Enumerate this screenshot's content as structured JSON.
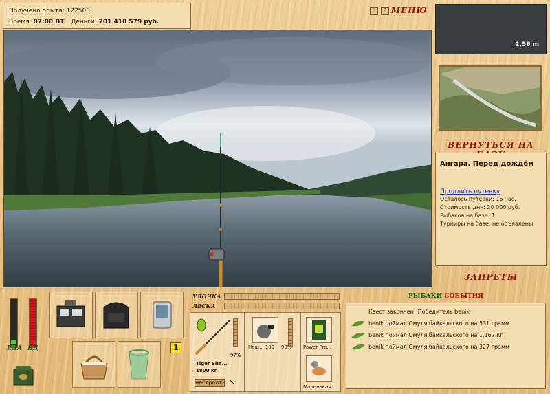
{
  "header": {
    "experience_label": "Получено опыта:",
    "experience_value": "122500",
    "time_label": "Время:",
    "time_value": "07:00 ВТ",
    "money_label": "Деньги:",
    "money_value": "201 410 579 руб.",
    "pause_icon": "II",
    "help_icon": "?",
    "menu_label": "МЕНЮ"
  },
  "depth": {
    "value": "2,56 m"
  },
  "location": {
    "return_label": "ВЕРНУТЬСЯ НА БАЗУ",
    "name": "Ангара. Перед дождём",
    "extend_link": "Продлить путевку",
    "remaining": "Осталось путевки: 16 час.",
    "cost": "Стоимость дня: 20 000 руб.",
    "fishers": "Рыбаков на базе: 1",
    "tournaments": "Турниры на базе: не объявлены",
    "bans_label": "ЗАПРЕТЫ"
  },
  "needs": {
    "food_label": "ЕДА",
    "drink_label": "ВД",
    "food_level": 0.15,
    "drink_level": 1.0
  },
  "inventory": {
    "badge": "1"
  },
  "tackle": {
    "rod_label": "УДОЧКА",
    "line_label": "ЛЕСКА",
    "rod_name": "Tiger Sha...",
    "rod_weight": "1800 кг",
    "rod_percent": "97%",
    "reel_name": "Нош... 180",
    "reel_percent": "99%",
    "lure_name": "Power Pro...",
    "bait_name": "Маленькая",
    "setup_label": "настроить"
  },
  "events": {
    "title_a": "РЫБАКИ",
    "title_b": "СОБЫТИЯ",
    "items": [
      "Квест закончен! Победитель benik",
      "benik поймал Омуля байкальского на 531 грамм",
      "benik поймал Омуля байкальского на 1,167 кг",
      "benik поймал Омуля байкальского на 327 грамм"
    ]
  }
}
